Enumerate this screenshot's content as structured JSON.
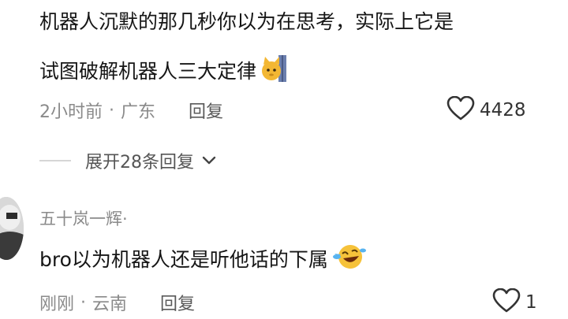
{
  "comment1": {
    "line1": "机器人沉默的那几秒你以为在思考，实际上它是",
    "line2": "试图破解机器人三大定律",
    "emoji": "cat-peeking-emoji",
    "time": "2小时前",
    "location": "广东",
    "reply_label": "回复",
    "likes": "4428"
  },
  "expand": {
    "label": "展开28条回复"
  },
  "comment2": {
    "username": "五十岚一辉·",
    "text": "bro以为机器人还是听他话的下属",
    "emoji": "laughing-tears-emoji",
    "time": "刚刚",
    "location": "云南",
    "reply_label": "回复",
    "likes": "1"
  },
  "colors": {
    "text": "#161616",
    "meta": "#8a8a8a",
    "divider": "#d6d6d6"
  }
}
